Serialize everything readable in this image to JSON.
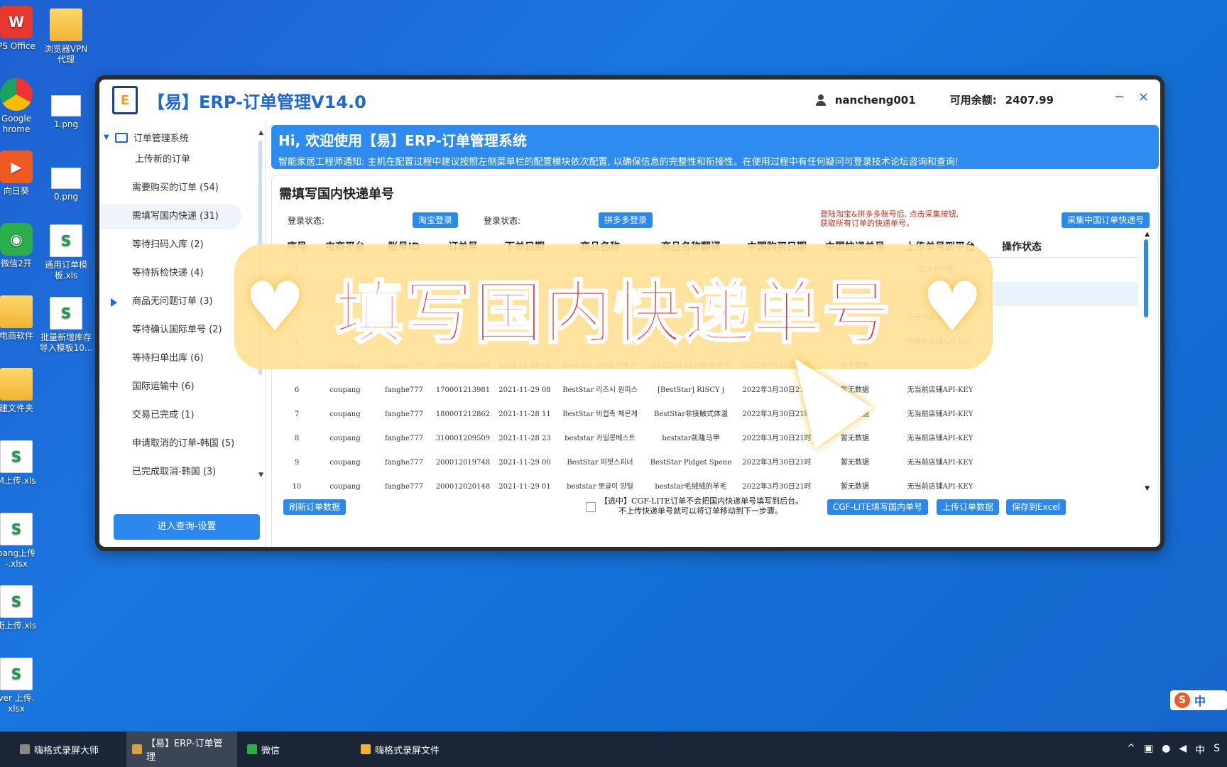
{
  "desktop": {
    "icons": [
      {
        "label": "PS Office"
      },
      {
        "label": "浏览器VPN\n代理"
      },
      {
        "label": "Google\nhrome"
      },
      {
        "label": "1.png"
      },
      {
        "label": "向日葵"
      },
      {
        "label": "0.png"
      },
      {
        "label": "微信2开"
      },
      {
        "label": "通用订单模\n板.xls"
      },
      {
        "label": "电商软件"
      },
      {
        "label": "批量新增库存\n导入模板10..."
      },
      {
        "label": "建文件夹"
      },
      {
        "label": "M上传.xls"
      },
      {
        "label": "pang上传\n-.xlsx"
      },
      {
        "label": "街上传.xls"
      },
      {
        "label": "ver 上传.\nxlsx"
      }
    ]
  },
  "window": {
    "title": "【易】ERP-订单管理V14.0",
    "logo_text": "E",
    "username": "nancheng001",
    "balance_label": "可用余额:",
    "balance_value": "2407.99",
    "minimize": "−",
    "close": "×"
  },
  "sidebar": {
    "root": "订单管理系统",
    "items": [
      {
        "label": "上传新的订单"
      },
      {
        "label": "需要购买的订单 (54)"
      },
      {
        "label": "需填写国内快递 (31)"
      },
      {
        "label": "等待扫码入库 (2)"
      },
      {
        "label": "等待拆检快递 (4)"
      },
      {
        "label": "商品无问题订单 (3)"
      },
      {
        "label": "等待确认国际单号 (2)"
      },
      {
        "label": "等待扫单出库 (6)"
      },
      {
        "label": "国际运输中 (6)"
      },
      {
        "label": "交易已完成 (1)"
      },
      {
        "label": "申请取消的订单-韩国 (5)"
      },
      {
        "label": "已完成取消-韩国 (3)"
      }
    ],
    "bottom_button": "进入查询-设置"
  },
  "banner": {
    "hi": "Hi, 欢迎使用【易】ERP-订单管理系统",
    "notice": "智能家居工程师通知: 主机在配置过程中建议按照左侧菜单栏的配置模块依次配置, 以确保信息的完整性和衔接性。在使用过程中有任何疑问可登录技术论坛咨询和查询!"
  },
  "panel": {
    "title": "需填写国内快递单号",
    "login_status_1": "登录状态:",
    "taobao_login": "淘宝登录",
    "login_status_2": "登录状态:",
    "pdd_login": "拼多多登录",
    "warning": "登陆淘宝&拼多多账号后, 点击采集按钮, 获取所有订单的快递单号。",
    "collect_button": "采集中国订单快递号"
  },
  "table": {
    "headers": [
      "序号",
      "电商平台",
      "账号ID",
      "订单号",
      "下单日期",
      "商品名称",
      "商品名称翻译",
      "中国购买日期",
      "中国快递单号",
      "上传单号到平台",
      "操作状态"
    ],
    "rows": [
      [
        "1",
        "",
        "",
        "",
        "",
        "",
        "",
        "",
        "",
        "您没有权限。",
        ""
      ],
      [
        "2",
        "",
        "",
        "",
        "",
        "",
        "",
        "",
        "",
        "",
        ""
      ],
      [
        "3",
        "",
        "",
        "",
        "",
        "",
        "",
        "",
        "",
        "无当前店铺API-KEY",
        ""
      ],
      [
        "4",
        "",
        "",
        "",
        "",
        "",
        "",
        "",
        "",
        "无当前店铺API-KEY",
        ""
      ],
      [
        "5",
        "coupang",
        "fanghe777",
        "250001204986",
        "2021-11-29 06",
        "Beststar 2019 가을 겨",
        "BESTAR 2019秋冬格子",
        "2022年3月30日21时",
        "暂无数据",
        "",
        ""
      ],
      [
        "6",
        "coupang",
        "fanghe777",
        "170001213981",
        "2021-11-29 08",
        "BestStar 리즈시 원피스",
        "[BestStar] RISCY j",
        "2022年3月30日21时",
        "暂无数据",
        "无当前店铺API-KEY",
        ""
      ],
      [
        "7",
        "coupang",
        "fanghe777",
        "180001212862",
        "2021-11-28 11",
        "BestStar 비접촉 체온계",
        "BestStar非接触式体温",
        "2022年3月30日21时",
        "暂无数据",
        "无当前店铺API-KEY",
        ""
      ],
      [
        "8",
        "coupang",
        "fanghe777",
        "310001209509",
        "2021-11-28 23",
        "beststar 카일롱베스트",
        "beststar凯隆马甲",
        "2022年3月30日21时",
        "暂无数据",
        "无当前店铺API-KEY",
        ""
      ],
      [
        "9",
        "coupang",
        "fanghe777",
        "200012019748",
        "2021-11-29 00",
        "BestStar 피젯스피너",
        "BestStar Pidget Spene",
        "2022年3月30日21时",
        "暂无数据",
        "无当前店铺API-KEY",
        ""
      ],
      [
        "10",
        "coupang",
        "fanghe777",
        "200012020148",
        "2021-11-29 01",
        "beststar 뽀글이 양털",
        "beststar毛绒绒的羊毛",
        "2022年3月30日21时",
        "暂无数据",
        "无当前店铺API-KEY",
        ""
      ]
    ]
  },
  "footer": {
    "refresh_button": "刷新订单数据",
    "note_line1": "【选中】CGF-LITE订单不会把国内快递单号填写到后台。",
    "note_line2": "不上传快递单号就可以将订单移动到下一步骤。",
    "cgf_button": "CGF-LITE填写国内单号",
    "upload_button": "上传订单数据",
    "excel_button": "保存到Excel"
  },
  "overlay": {
    "text": "填写国内快递单号"
  },
  "taskbar": {
    "items": [
      {
        "label": "嗨格式录屏大师"
      },
      {
        "label": "【易】ERP-订单管理"
      },
      {
        "label": "微信"
      },
      {
        "label": "嗨格式录屏文件"
      }
    ],
    "ime": "中",
    "tray_lang": "中"
  }
}
